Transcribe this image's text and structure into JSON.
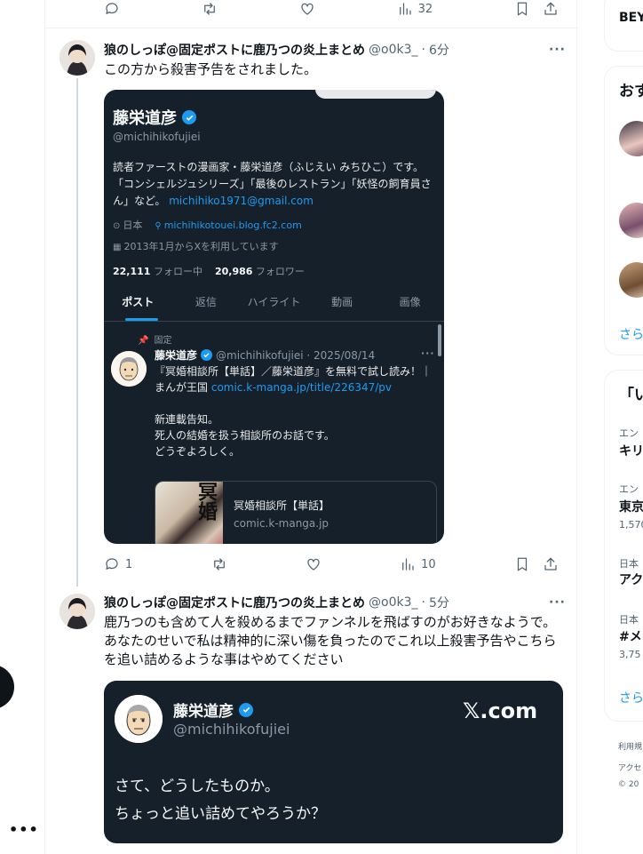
{
  "top_actions": {
    "views": "32"
  },
  "tweet1": {
    "name": "狼のしっぽ@固定ポストに鹿乃つの炎上まとめ",
    "handle": "@o0k3_",
    "sep": "·",
    "time": "6分",
    "text": "この方から殺害予告をされました。",
    "replies": "1",
    "views": "10"
  },
  "profile_shot": {
    "name": "藤栄道彦",
    "handle": "@michihikofujiei",
    "bio": "読者ファーストの漫画家・藤栄道彦（ふじえい みちひこ）です。「コンシェルジュシリーズ」「最後のレストラン」「妖怪の飼育員さん」など。",
    "bio_link": "michihiko1971@gmail.com",
    "location": "日本",
    "website": "michihikotouei.blog.fc2.com",
    "joined": "2013年1月からXを利用しています",
    "following_count": "22,111",
    "following_label": "フォロー中",
    "followers_count": "20,986",
    "followers_label": "フォロワー",
    "tabs": [
      "ポスト",
      "返信",
      "ハイライト",
      "動画",
      "画像"
    ],
    "pinned_label": "固定",
    "post": {
      "name": "藤栄道彦",
      "meta": "@michihikofujiei · 2025/08/14",
      "text_line1": "『冥婚相談所【単話】／藤栄道彦』を無料で試し読み！｜まんが王国",
      "text_link": "comic.k-manga.jp/title/226347/pv",
      "text_line2": "新連載告知。",
      "text_line3": "死人の結婚を扱う相談所のお話です。",
      "text_line4": "どうぞよろしく。",
      "card_title": "冥婚相談所【単話】",
      "card_domain": "comic.k-manga.jp"
    }
  },
  "tweet2": {
    "name": "狼のしっぽ@固定ポストに鹿乃つの炎上まとめ",
    "handle": "@o0k3_",
    "sep": "·",
    "time": "5分",
    "text_line1": "鹿乃つのも含めて人を殺めるまでファンネルを飛ばすのがお好きなようで。",
    "text_line2": "あなたのせいで私は精神的に深い傷を負ったのでこれ以上殺害予告やこちらを追い詰めるような事はやめてください"
  },
  "quote_card": {
    "name": "藤栄道彦",
    "handle": "@michihikofujiei",
    "brand": "𝕏.com",
    "line1": "さて、どうしたものか。",
    "line2": "ちょっと追い詰めてやろうか？"
  },
  "sidebar": {
    "frag_beyond": "BEY",
    "frag_recommend": "おす",
    "frag_more1": "さら",
    "frag_trend_head": "「い",
    "trend1_cat": "エン",
    "trend1_title": "キリ",
    "trend2_cat": "エン",
    "trend2_title": "東京",
    "trend2_count": "1,570",
    "trend3_cat": "日本",
    "trend3_title": "アク",
    "trend4_cat": "日本",
    "trend4_title": "#メ",
    "trend4_count": "3,75",
    "frag_more2": "さら",
    "foot1": "利用規",
    "foot2": "アクセ",
    "foot3": "© 20"
  },
  "colors": {
    "accent": "#1d9bf0",
    "dark_card": "#15202b",
    "muted": "#536471"
  },
  "icons": [
    "reply-icon",
    "retweet-icon",
    "like-icon",
    "views-icon",
    "bookmark-icon",
    "share-icon",
    "verified-badge-icon",
    "more-icon"
  ]
}
